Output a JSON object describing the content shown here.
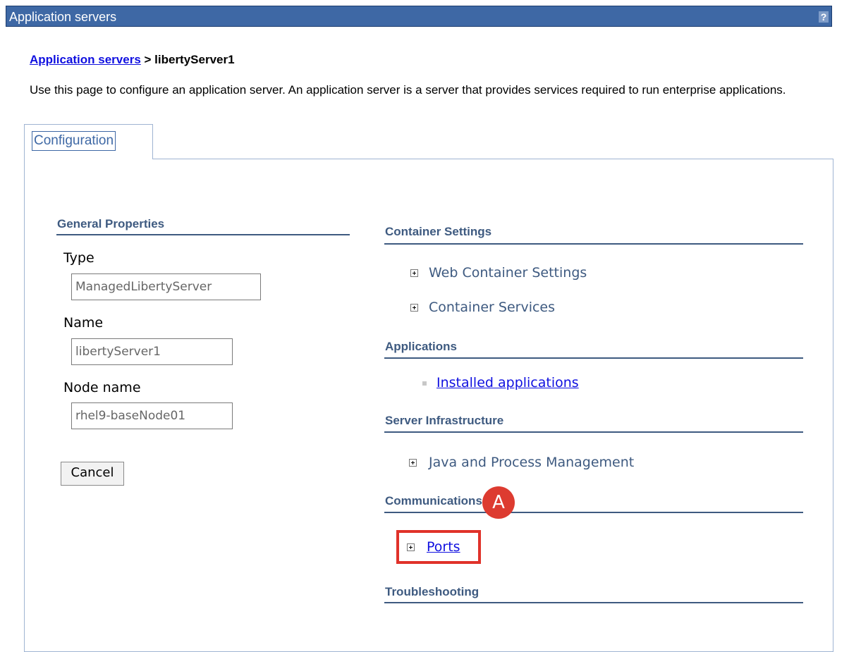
{
  "window": {
    "title": "Application servers",
    "help_glyph": "?"
  },
  "breadcrumb": {
    "link": "Application servers",
    "separator": " > ",
    "current": "libertyServer1"
  },
  "description": "Use this page to configure an application server. An application server is a server that provides services required to run enterprise applications.",
  "tabs": [
    {
      "label": "Configuration",
      "active": true
    }
  ],
  "general_properties": {
    "title": "General Properties",
    "fields": [
      {
        "label": "Type",
        "value": "ManagedLibertyServer"
      },
      {
        "label": "Name",
        "value": "libertyServer1"
      },
      {
        "label": "Node name",
        "value": "rhel9-baseNode01"
      }
    ],
    "cancel_label": "Cancel"
  },
  "sections": {
    "container_settings": {
      "title": "Container Settings",
      "items": [
        "Web Container Settings",
        "Container Services"
      ]
    },
    "applications": {
      "title": "Applications",
      "items": [
        "Installed applications"
      ]
    },
    "server_infrastructure": {
      "title": "Server Infrastructure",
      "items": [
        "Java and Process Management"
      ]
    },
    "communications": {
      "title": "Communications",
      "items": [
        "Ports"
      ]
    },
    "troubleshooting": {
      "title": "Troubleshooting"
    }
  },
  "annotation": {
    "marker_label": "A",
    "marker_color": "#dd3b30",
    "box_color": "#e0322a"
  },
  "colors": {
    "titlebar": "#3e68a5",
    "section_heading": "#3e5a80",
    "link": "#1010e0"
  }
}
